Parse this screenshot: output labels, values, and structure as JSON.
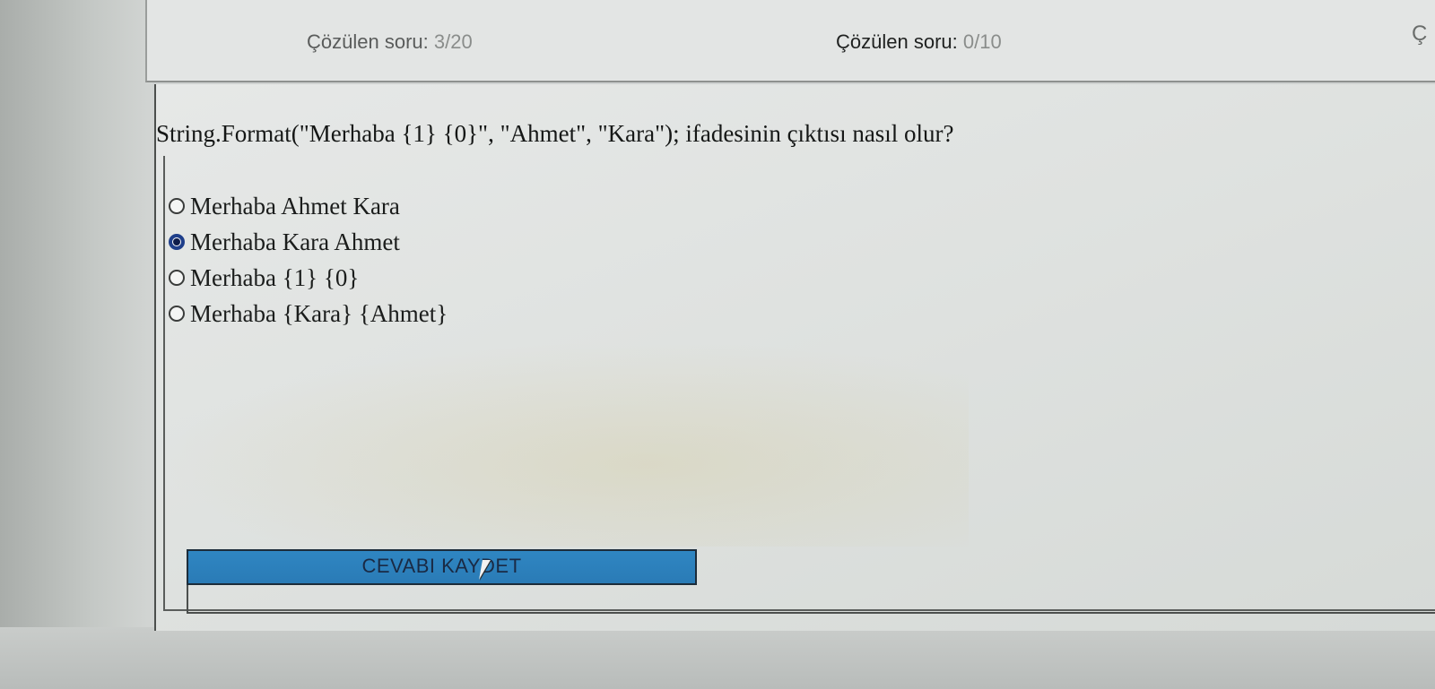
{
  "header": {
    "counter_1": {
      "label": "Çözülen soru:",
      "value": "3/20"
    },
    "counter_2": {
      "label": "Çözülen soru:",
      "value": "0/10"
    },
    "counter_3": {
      "label": "Ç"
    }
  },
  "question": {
    "text": "String.Format(\"Merhaba {1} {0}\", \"Ahmet\", \"Kara\"); ifadesinin çıktısı nasıl olur?",
    "options": [
      {
        "label": "Merhaba Ahmet Kara",
        "selected": false
      },
      {
        "label": "Merhaba Kara Ahmet",
        "selected": true
      },
      {
        "label": "Merhaba {1} {0}",
        "selected": false
      },
      {
        "label": "Merhaba {Kara} {Ahmet}",
        "selected": false
      }
    ]
  },
  "save_button": {
    "label": "CEVABI KAYDET"
  },
  "colors": {
    "button_bg": "#2f86c2",
    "radio_selected": "#1f3f8a"
  }
}
